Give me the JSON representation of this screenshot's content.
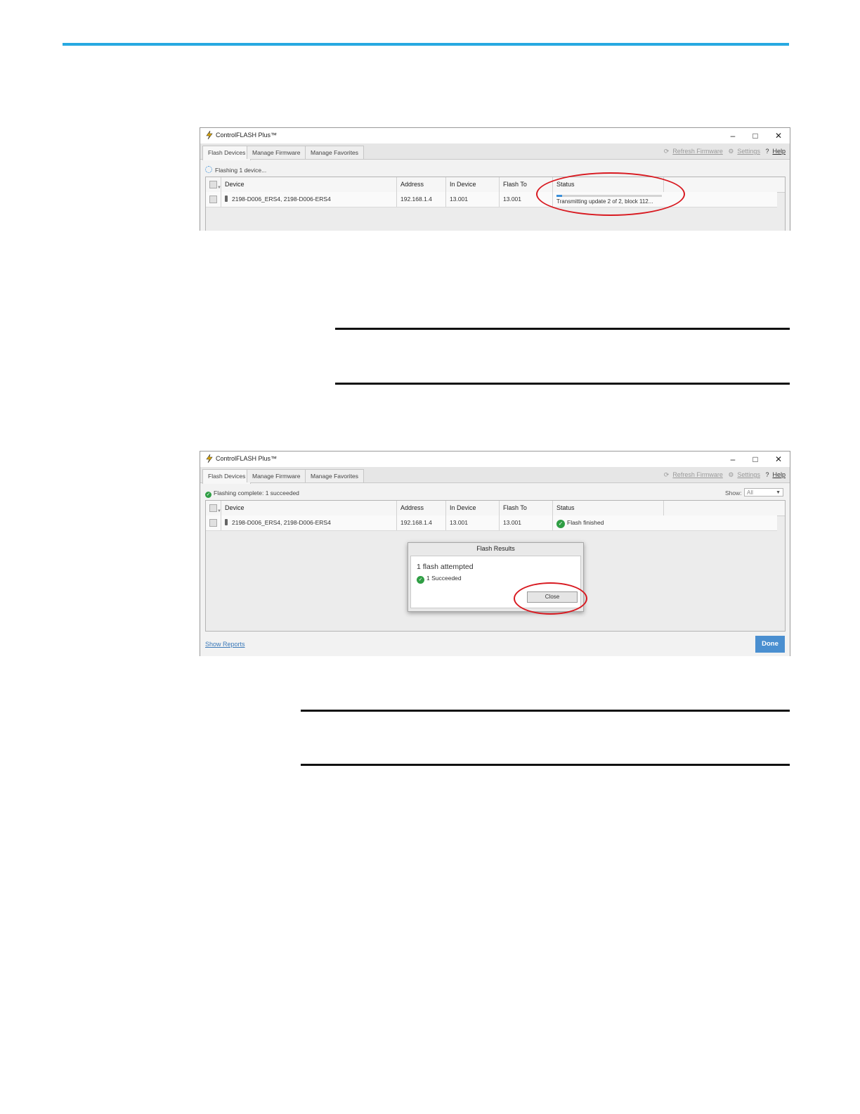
{
  "screenshot1": {
    "app_title": "ControlFLASH Plus™",
    "tabs": [
      "Flash Devices",
      "Manage Firmware",
      "Manage Favorites"
    ],
    "links": {
      "refresh": "Refresh Firmware",
      "settings": "Settings",
      "help_mark": "?",
      "help": "Help"
    },
    "status_line": "Flashing 1 device...",
    "columns": [
      "Device",
      "Address",
      "In Device",
      "Flash To",
      "Status"
    ],
    "row": {
      "device": "2198-D006_ERS4, 2198-D006-ERS4",
      "address": "192.168.1.4",
      "in_device": "13.001",
      "flash_to": "13.001",
      "status": "Transmitting update 2 of 2, block 112...",
      "progress": 0.05
    }
  },
  "screenshot2": {
    "app_title": "ControlFLASH Plus™",
    "tabs": [
      "Flash Devices",
      "Manage Firmware",
      "Manage Favorites"
    ],
    "links": {
      "refresh": "Refresh Firmware",
      "settings": "Settings",
      "help_mark": "?",
      "help": "Help"
    },
    "status_line": "Flashing complete: 1 succeeded",
    "show_label": "Show:",
    "show_value": "All",
    "columns": [
      "Device",
      "Address",
      "In Device",
      "Flash To",
      "Status"
    ],
    "row": {
      "device": "2198-D006_ERS4, 2198-D006-ERS4",
      "address": "192.168.1.4",
      "in_device": "13.001",
      "flash_to": "13.001",
      "status": "Flash finished"
    },
    "dialog": {
      "title": "Flash Results",
      "summary": "1 flash attempted",
      "succeeded": "1 Succeeded",
      "close_label": "Close"
    },
    "show_reports": "Show Reports",
    "done_label": "Done"
  },
  "colors": {
    "accent_rule": "#27a9e1",
    "highlight_oval": "#d81920",
    "done_button": "#4a8fd0",
    "success": "#2f9e44"
  }
}
